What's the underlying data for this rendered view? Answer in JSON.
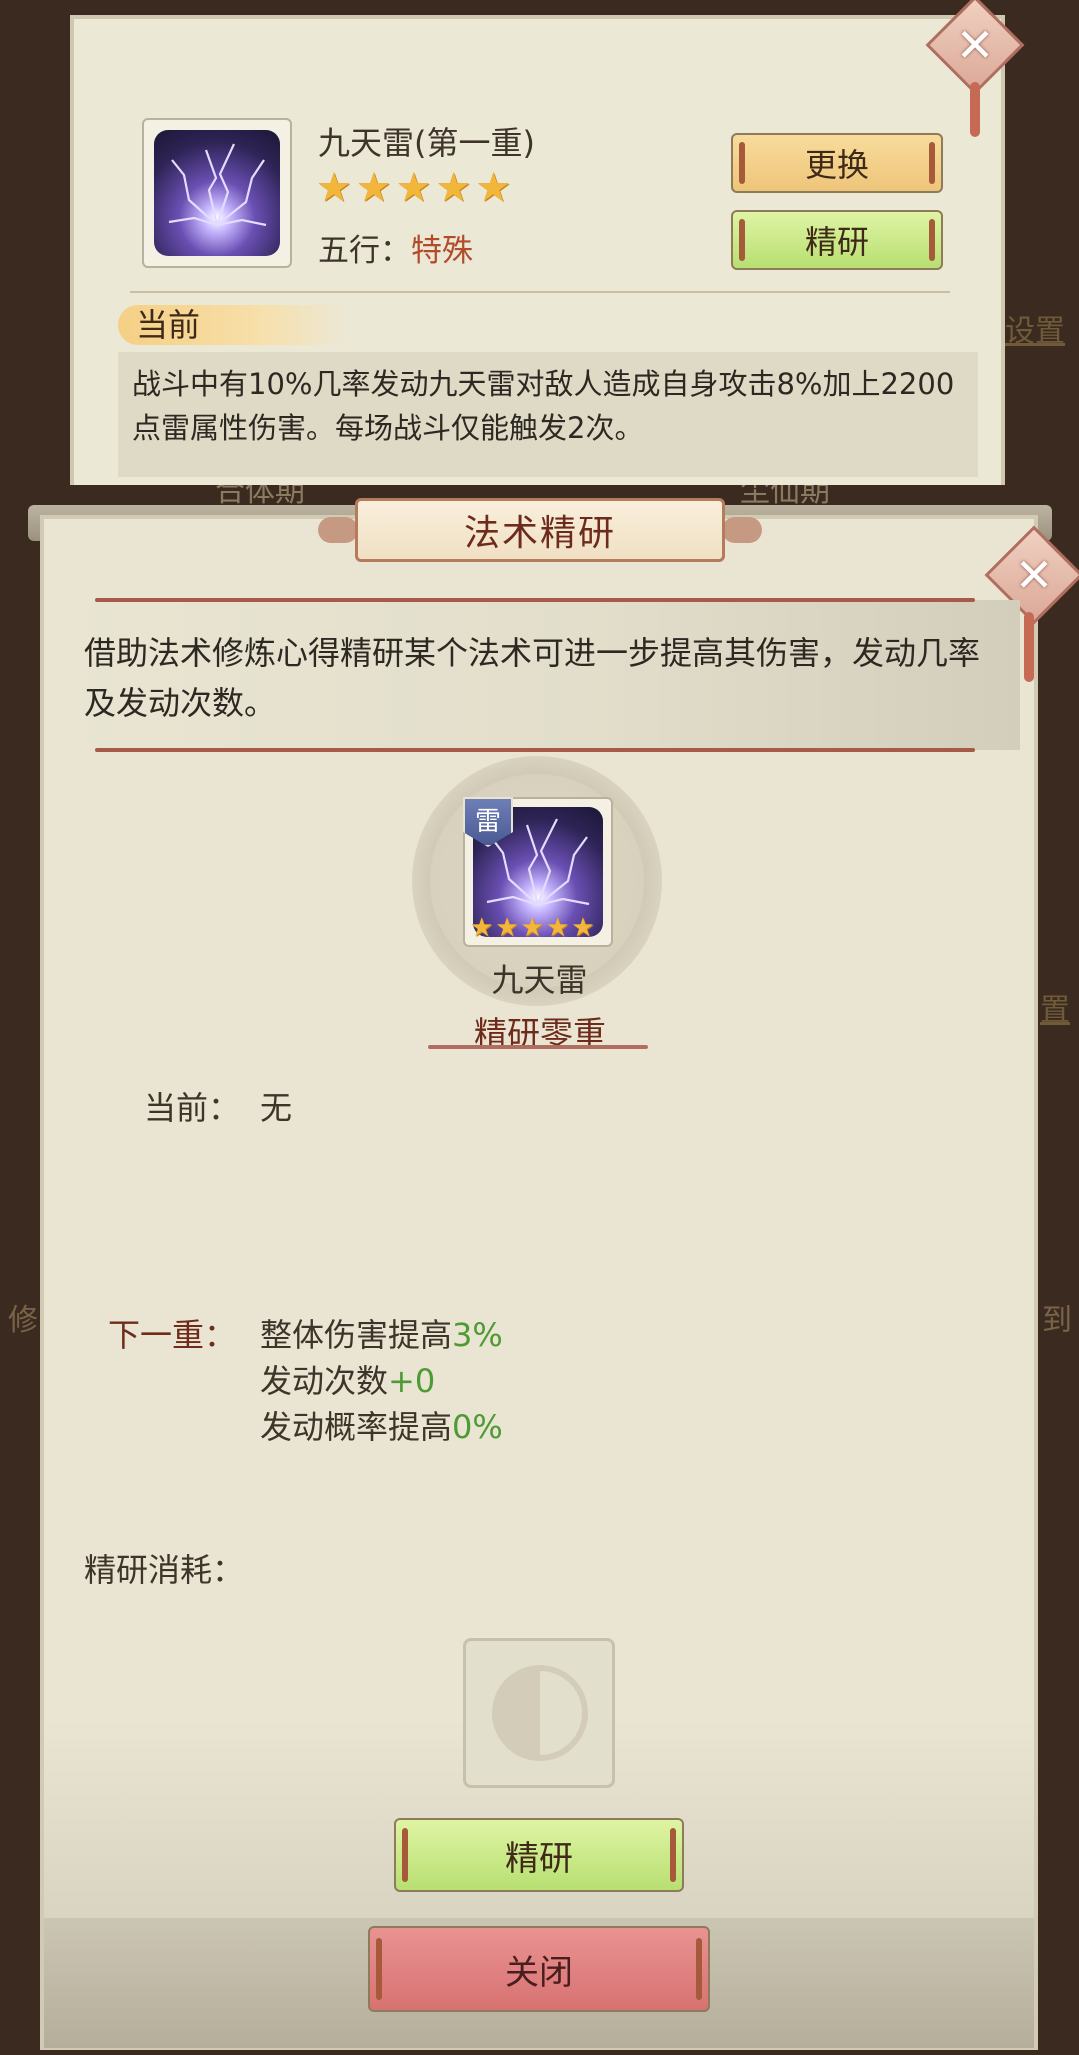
{
  "background": {
    "right_link_1": "设置",
    "right_link_2": "置",
    "left_char": "修",
    "right_char": "到",
    "bg_text_left": "合体期",
    "bg_text_right": "尘仙期"
  },
  "skill_card": {
    "title": "九天雷(第一重)",
    "star_glyph": "★",
    "star_count": 5,
    "wuxing_label": "五行：",
    "wuxing_value": "特殊",
    "change_button": "更换",
    "research_button": "精研",
    "section_tab": "当前",
    "description": "战斗中有10%几率发动九天雷对敌人造成自身攻击8%加上2200点雷属性伤害。每场战斗仅能触发2次。",
    "icon": "lightning-spell-icon",
    "close_icon": "close-icon"
  },
  "research_dialog": {
    "title": "法术精研",
    "intro": "借助法术修炼心得精研某个法术可进一步提高其伤害，发动几率及发动次数。",
    "badge": "雷",
    "skill_name": "九天雷",
    "level": "精研零重",
    "current_label": "当前：",
    "current_value": "无",
    "next_label": "下一重：",
    "next_effects": [
      {
        "text": "整体伤害提高",
        "value": "3%"
      },
      {
        "text": "发动次数",
        "value": "+0"
      },
      {
        "text": "发动概率提高",
        "value": "0%"
      }
    ],
    "cost_label": "精研消耗：",
    "cost_slot_icon": "yin-yang-icon",
    "research_button": "精研",
    "close_button": "关闭",
    "accent_green": "#4f9a34",
    "accent_red": "#6e2b1b"
  }
}
